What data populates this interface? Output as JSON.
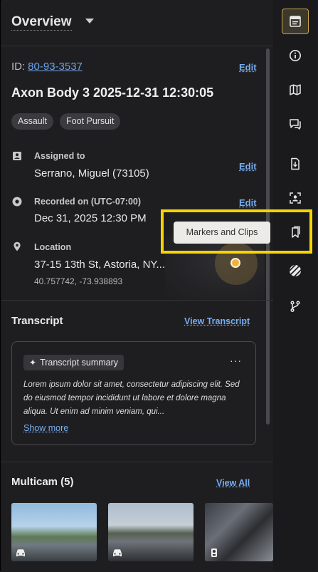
{
  "header": {
    "title": "Overview"
  },
  "evidence": {
    "id_label": "ID:",
    "id": "80-93-3537",
    "title": "Axon Body 3 2025-12-31 12:30:05",
    "tags": [
      "Assault",
      "Foot Pursuit"
    ],
    "edit_label": "Edit",
    "assigned": {
      "label": "Assigned to",
      "value": "Serrano, Miguel (73105)"
    },
    "recorded": {
      "label": "Recorded on (UTC-07:00)",
      "value": "Dec 31, 2025 12:30 PM"
    },
    "location": {
      "label": "Location",
      "value": "37-15 13th St, Astoria, NY...",
      "coords": "40.757742, -73.938893"
    }
  },
  "transcript": {
    "title": "Transcript",
    "link": "View Transcript",
    "summary_label": "Transcript summary",
    "more": "···",
    "summary_text": "Lorem ipsum dolor sit amet, consectetur adipiscing elit. Sed do eiusmod tempor incididunt ut labore et dolore magna aliqua. Ut enim ad minim veniam, qui...",
    "show_more": "Show more"
  },
  "multicam": {
    "title": "Multicam (5)",
    "link": "View All",
    "thumbnails": [
      {
        "source": "vehicle-camera",
        "icon": "car-icon"
      },
      {
        "source": "vehicle-camera",
        "icon": "car-icon"
      },
      {
        "source": "body-camera",
        "icon": "body-camera-icon"
      }
    ]
  },
  "rail": {
    "items": [
      "overview",
      "info",
      "map",
      "comments",
      "download",
      "redaction",
      "markers-and-clips",
      "restricted",
      "workflow"
    ],
    "active": "overview"
  },
  "tooltip": {
    "text": "Markers and Clips"
  },
  "colors": {
    "accent_link": "#78aef0",
    "highlight": "#f5d400",
    "active_border": "#c9a54a",
    "pin": "#f2b13b"
  }
}
